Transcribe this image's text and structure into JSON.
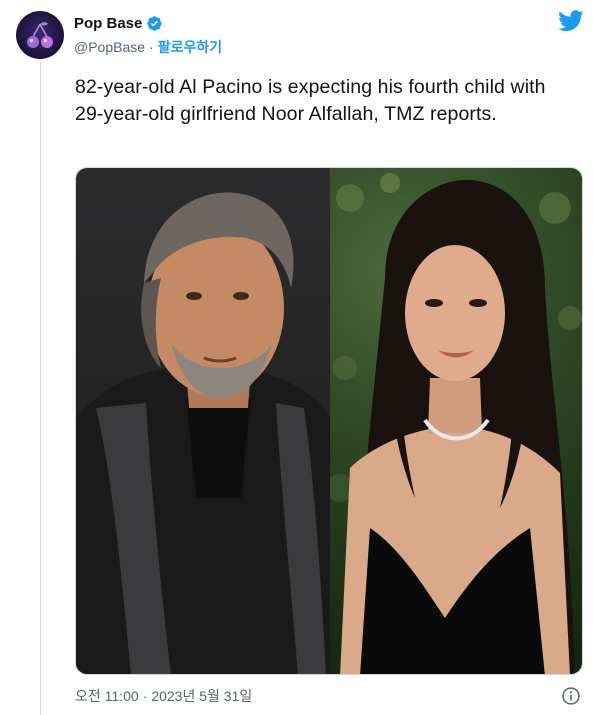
{
  "author": {
    "display_name": "Pop Base",
    "handle": "@PopBase",
    "separator": "·",
    "follow_label": "팔로우하기",
    "verified": true
  },
  "tweet": {
    "text": "82-year-old Al Pacino is expecting his fourth child with 29-year-old girlfriend Noor Alfallah, TMZ reports.",
    "media": [
      {
        "description": "photo-al-pacino"
      },
      {
        "description": "photo-noor-alfallah"
      }
    ]
  },
  "footer": {
    "time": "오전 11:00",
    "separator": "·",
    "date": "2023년 5월 31일"
  },
  "colors": {
    "accent": "#1d9bf0",
    "text_primary": "#0f1419",
    "text_secondary": "#536471",
    "border": "#cfd9de"
  },
  "icons": {
    "verified": "verified-badge-icon",
    "brand": "twitter-bird-icon",
    "info": "info-icon"
  }
}
